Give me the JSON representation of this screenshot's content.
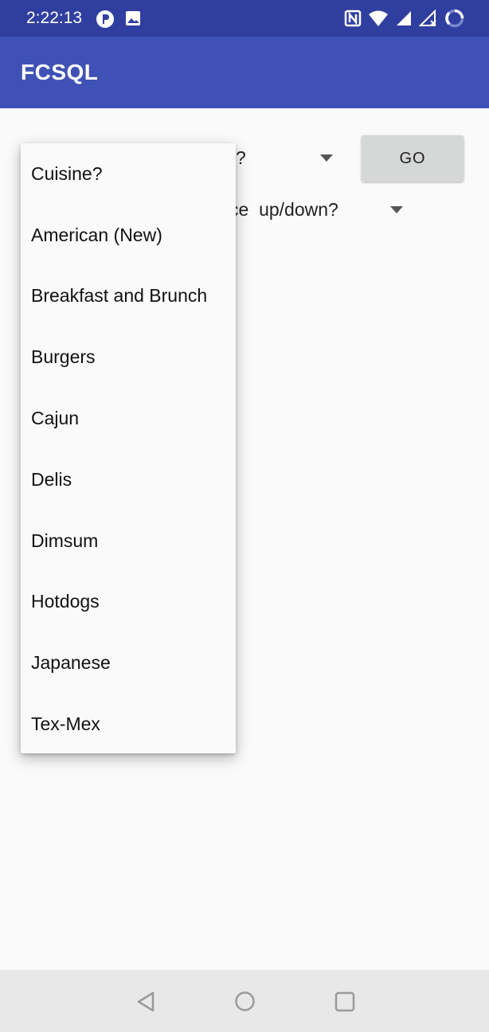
{
  "status_bar": {
    "time": "2:22:13",
    "left_icons": [
      "app-notification-icon",
      "image-icon"
    ],
    "right_icons": [
      "nfc-icon",
      "wifi-icon",
      "cell-signal-icon",
      "no-signal-icon",
      "loading-icon"
    ]
  },
  "app_bar": {
    "title": "FCSQL"
  },
  "form": {
    "cuisine_spinner_visible": "?",
    "go_label": "GO",
    "sort_spinner_visible": "ce  up/down?"
  },
  "dropdown": {
    "items": [
      "Cuisine?",
      "American (New)",
      "Breakfast and Brunch",
      "Burgers",
      "Cajun",
      "Delis",
      "Dimsum",
      "Hotdogs",
      "Japanese",
      "Tex-Mex"
    ]
  },
  "nav_bar": {
    "buttons": [
      "back-icon",
      "home-icon",
      "recents-icon"
    ]
  },
  "colors": {
    "status_bar": "#303f9f",
    "app_bar": "#3f51b5",
    "background": "#fafafa",
    "button": "#d6d7d7"
  }
}
